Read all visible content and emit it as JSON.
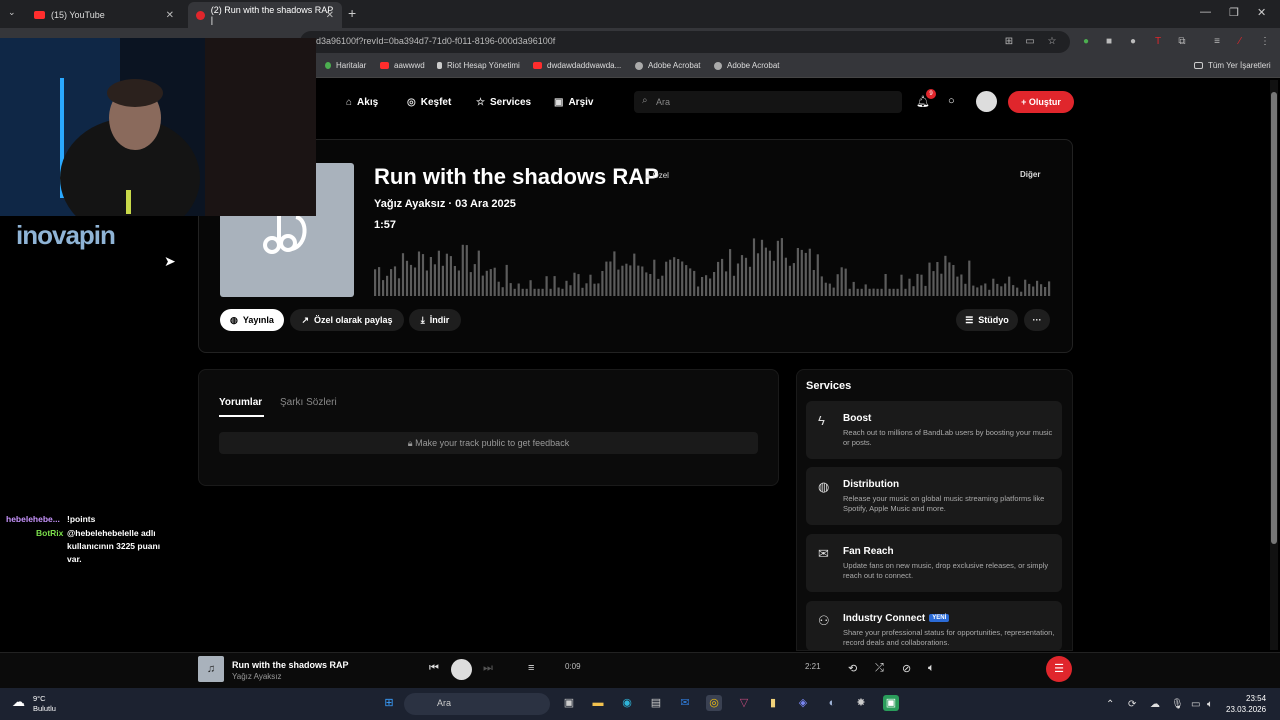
{
  "browser": {
    "tabs": [
      {
        "label": "(15) YouTube"
      },
      {
        "label": "(2) Run with the shadows RAP |"
      }
    ],
    "url": "d3a96100f?revId=0ba394d7-71d0-f011-8196-000d3a96100f",
    "bookmarks": [
      "Haritalar",
      "aawwwd",
      "Riot Hesap Yönetimi",
      "dwdawdaddwawda...",
      "Adobe Acrobat",
      "Adobe Acrobat"
    ],
    "all_bookmarks": "Tüm Yer İşaretleri"
  },
  "nav": {
    "links": [
      "Akış",
      "Keşfet",
      "Services",
      "Arşiv"
    ],
    "search_placeholder": "Ara",
    "notification_count": "9",
    "create_label": "Oluştur"
  },
  "track": {
    "title": "Run with the shadows RAP",
    "privacy": "Özel",
    "artist_line": "Yağız Ayaksız · 03 Ara 2025",
    "duration": "1:57",
    "other_label": "Diğer",
    "actions": {
      "publish": "Yayınla",
      "share_private": "Özel olarak paylaş",
      "download": "İndir",
      "studio": "Stüdyo"
    }
  },
  "comments": {
    "tabs": [
      "Yorumlar",
      "Şarkı Sözleri"
    ],
    "feedback_notice": "Make your track public to get feedback"
  },
  "services": {
    "title": "Services",
    "items": [
      {
        "name": "Boost",
        "desc": "Reach out to millions of BandLab users by boosting your music or posts.",
        "icon": "bolt-icon"
      },
      {
        "name": "Distribution",
        "desc": "Release your music on global music streaming platforms like Spotify, Apple Music and more.",
        "icon": "globe-icon"
      },
      {
        "name": "Fan Reach",
        "desc": "Update fans on new music, drop exclusive releases, or simply reach out to connect.",
        "icon": "mail-icon"
      },
      {
        "name": "Industry Connect",
        "badge": "YENİ",
        "desc": "Share your professional status for opportunities, representation, record deals and collaborations.",
        "icon": "people-icon"
      }
    ]
  },
  "overlay": {
    "logo": "inovapin",
    "chat": [
      {
        "user": "hebelehebe...",
        "msg": "!points"
      },
      {
        "user": "BotRix",
        "msg": "@hebelehebelelle adlı kullanıcının 3225 puanı var."
      }
    ]
  },
  "player": {
    "title": "Run with the shadows RAP",
    "artist": "Yağız Ayaksız",
    "current_time": "0:09",
    "total_time": "2:21"
  },
  "taskbar": {
    "weather_temp": "9°C",
    "weather_desc": "Bulutlu",
    "search_label": "Ara",
    "time": "23:54",
    "date": "23.03.2026"
  },
  "colors": {
    "accent": "#e0262c",
    "cover": "#a9b2bc",
    "waveform": "#5c5c5c"
  }
}
